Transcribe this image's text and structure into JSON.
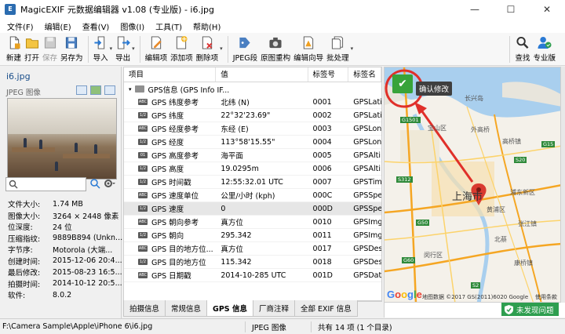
{
  "window": {
    "title": "MagicEXIF 元数据编辑器 v1.08 (专业版) - i6.jpg"
  },
  "menu": [
    "文件(F)",
    "编辑(E)",
    "查看(V)",
    "图像(I)",
    "工具(T)",
    "帮助(H)"
  ],
  "toolbar": {
    "new": "新建",
    "open": "打开",
    "save": "保存",
    "save_as": "另存为",
    "import": "导入",
    "export": "导出",
    "edit_item": "编辑项",
    "add_item": "添加项",
    "delete_item": "删除项",
    "jpeg_segment": "JPEG段",
    "rebuild": "原图重构",
    "edit_wizard": "编辑向导",
    "batch": "批处理",
    "find": "查找",
    "pro": "专业版"
  },
  "left": {
    "file_name": "i6.jpg",
    "file_type": "JPEG 图像",
    "props": [
      {
        "k": "文件大小:",
        "v": "1.74 MB"
      },
      {
        "k": "图像大小:",
        "v": "3264 × 2448 像素"
      },
      {
        "k": "位深度:",
        "v": "24 位"
      },
      {
        "k": "压缩指纹:",
        "v": "9889B894 (Unkn..."
      },
      {
        "k": "字节序:",
        "v": "Motorola (大端..."
      },
      {
        "k": "创建时间:",
        "v": "2015-12-06 20:4..."
      },
      {
        "k": "最后修改:",
        "v": "2015-08-23 16:5..."
      },
      {
        "k": "拍摄时间:",
        "v": "2014-10-12 20:5..."
      },
      {
        "k": "软件:",
        "v": "8.0.2"
      }
    ]
  },
  "table": {
    "headers": [
      "项目",
      "值",
      "标签号",
      "标签名"
    ],
    "group": "GPS信息 (GPS Info IF...",
    "rows": [
      {
        "tag": "ABC",
        "item": "GPS 纬度参考",
        "value": "北纬 (N)",
        "num": "0001",
        "name": "GPSLati"
      },
      {
        "tag": "1/2",
        "item": "GPS 纬度",
        "value": "22°32'23.69\"",
        "num": "0002",
        "name": "GPSLati"
      },
      {
        "tag": "ABC",
        "item": "GPS 经度参考",
        "value": "东经 (E)",
        "num": "0003",
        "name": "GPSLon"
      },
      {
        "tag": "1/2",
        "item": "GPS 经度",
        "value": "113°58'15.55\"",
        "num": "0004",
        "name": "GPSLon"
      },
      {
        "tag": "01",
        "item": "GPS 高度参考",
        "value": "海平面",
        "num": "0005",
        "name": "GPSAlti"
      },
      {
        "tag": "1/2",
        "item": "GPS 高度",
        "value": "19.0295m",
        "num": "0006",
        "name": "GPSAlti"
      },
      {
        "tag": "1/2",
        "item": "GPS 时间戳",
        "value": "12:55:32.01 UTC",
        "num": "0007",
        "name": "GPSTim"
      },
      {
        "tag": "ABC",
        "item": "GPS 速度单位",
        "value": "公里/小时 (kph)",
        "num": "000C",
        "name": "GPSSpe"
      },
      {
        "tag": "1/2",
        "item": "GPS 速度",
        "value": "0",
        "num": "000D",
        "name": "GPSSpe"
      },
      {
        "tag": "ABC",
        "item": "GPS 朝向参考",
        "value": "真方位",
        "num": "0010",
        "name": "GPSImg"
      },
      {
        "tag": "1/2",
        "item": "GPS 朝向",
        "value": "295.342",
        "num": "0011",
        "name": "GPSImg"
      },
      {
        "tag": "ABC",
        "item": "GPS 目的地方位...",
        "value": "真方位",
        "num": "0017",
        "name": "GPSDes"
      },
      {
        "tag": "1/2",
        "item": "GPS 目的地方位",
        "value": "115.342",
        "num": "0018",
        "name": "GPSDes"
      },
      {
        "tag": "ABC",
        "item": "GPS 日期戳",
        "value": "2014-10-285 UTC",
        "num": "001D",
        "name": "GPSDat"
      }
    ],
    "selected_row": 8
  },
  "tabs": [
    "拍摄信息",
    "常规信息",
    "GPS 信息",
    "厂商注释",
    "全部 EXIF 信息"
  ],
  "active_tab": 2,
  "map": {
    "confirm_tooltip": "确认修改",
    "city_label": "上海市",
    "google": "Google",
    "copyright": "地图数据 ©2017 GS(2011)6020 Google",
    "terms": "使用条款",
    "place_labels": [
      "长兴岛",
      "外高桥",
      "高桥镇",
      "宝山区",
      "浦东新区",
      "闵行区",
      "黄浦区",
      "张江镇",
      "康桥镇",
      "北蔡",
      "G1501",
      "S312",
      "S20",
      "G60",
      "G50",
      "G15",
      "S2"
    ]
  },
  "status": {
    "path": "F:\\Camera Sample\\Apple\\iPhone 6\\i6.jpg",
    "format": "JPEG 图像",
    "count": "共有 14 项 (1 个目录)",
    "badge": "未发现问题"
  }
}
